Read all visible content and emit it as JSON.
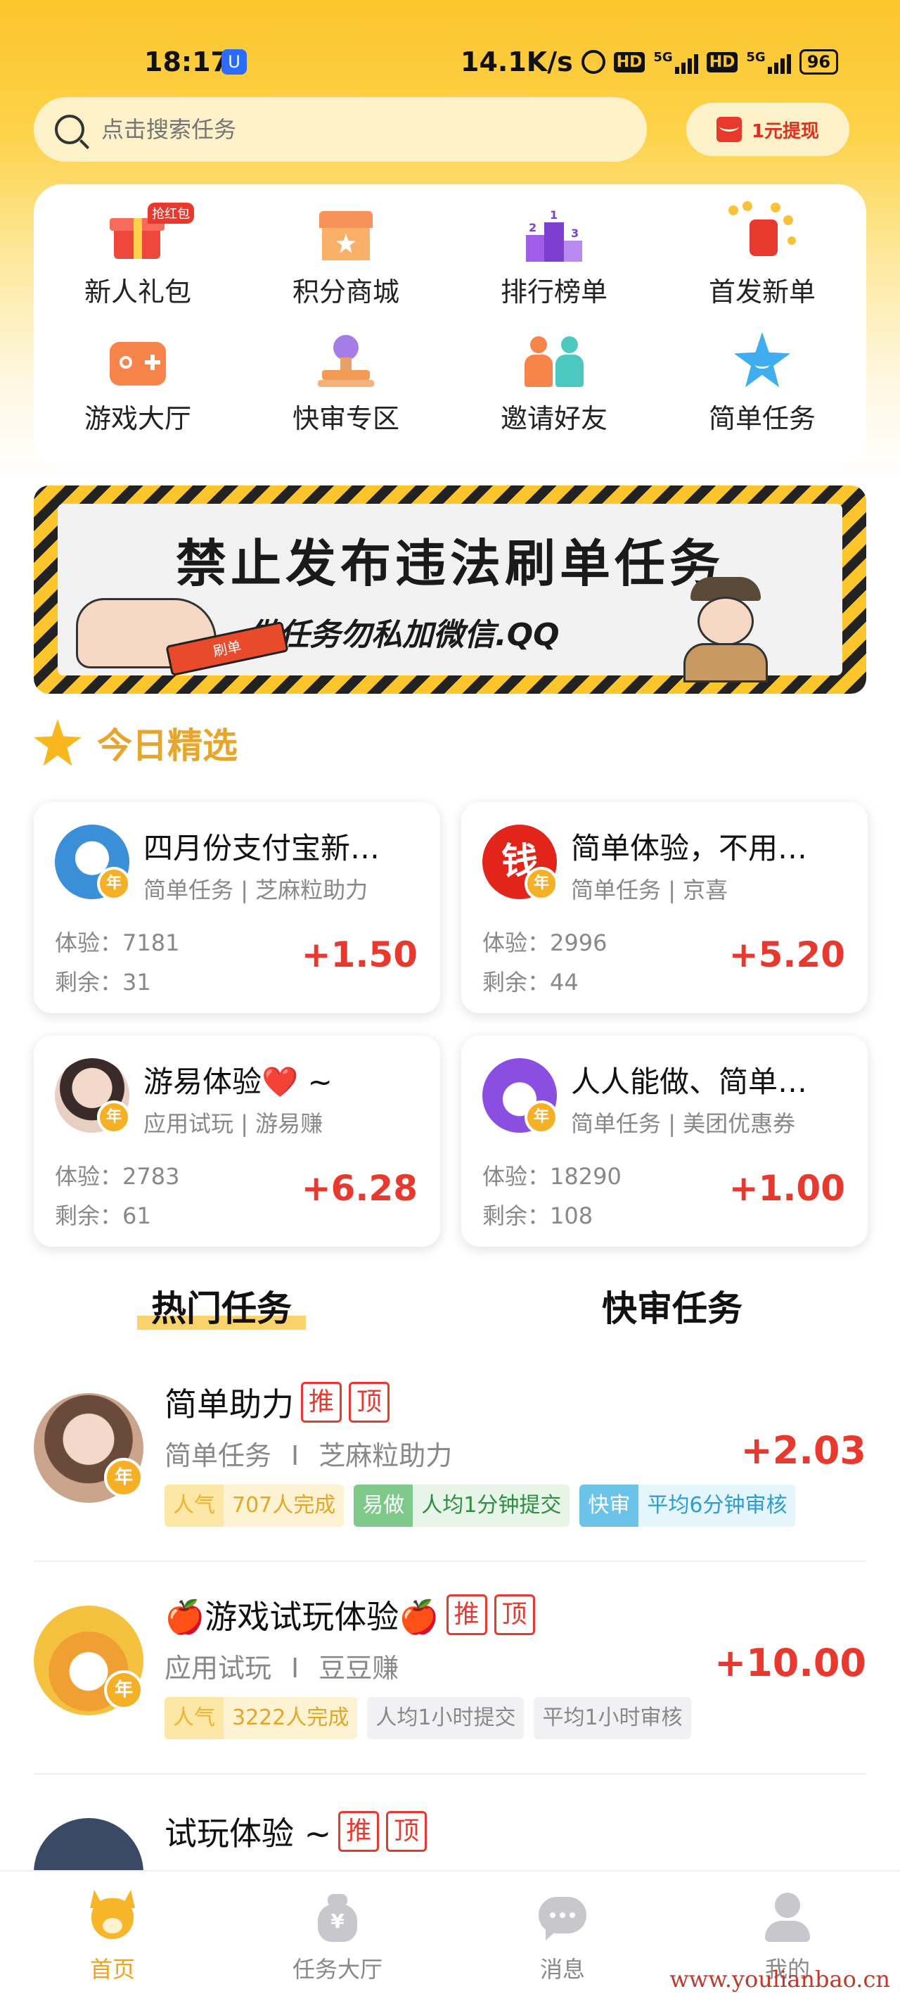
{
  "status_bar": {
    "time": "18:17",
    "speed": "14.1K/s",
    "hd1": "HD",
    "net1": "5G",
    "hd2": "HD",
    "net2": "5G",
    "battery": "96"
  },
  "search": {
    "placeholder": "点击搜索任务",
    "withdraw_label": "1元提现"
  },
  "quick_menu": [
    {
      "label": "新人礼包",
      "icon": "gift-icon",
      "badge": "抢红包"
    },
    {
      "label": "积分商城",
      "icon": "store-icon"
    },
    {
      "label": "排行榜单",
      "icon": "podium-icon",
      "ranks": [
        "1",
        "2",
        "3"
      ]
    },
    {
      "label": "首发新单",
      "icon": "coins-icon"
    },
    {
      "label": "游戏大厅",
      "icon": "gamepad-icon"
    },
    {
      "label": "快审专区",
      "icon": "stamp-icon"
    },
    {
      "label": "邀请好友",
      "icon": "people-icon"
    },
    {
      "label": "简单任务",
      "icon": "star-smile-icon"
    }
  ],
  "banner": {
    "title": "禁止发布违法刷单任务",
    "subtitle": "做任务勿私加微信.QQ",
    "phone_text": "刷单"
  },
  "today_pick": {
    "title": "今日精选",
    "stat_labels": {
      "exp": "体验：",
      "remain": "剩余："
    },
    "items": [
      {
        "title": "四月份支付宝新…",
        "category": "简单任务",
        "source": "芝麻粒助力",
        "exp": "7181",
        "remain": "31",
        "price": "+1.50",
        "avatar_color": "#3a8fd8",
        "year": "年"
      },
      {
        "title": "简单体验，不用…",
        "category": "简单任务",
        "source": "京喜",
        "exp": "2996",
        "remain": "44",
        "price": "+5.20",
        "avatar_color": "#e3241b",
        "avatar_char": "钱",
        "year": "年"
      },
      {
        "title": "游易体验❤️ ~",
        "category": "应用试玩",
        "source": "游易赚",
        "exp": "2783",
        "remain": "61",
        "price": "+6.28",
        "avatar_color": "#e9cfc2",
        "year": "年"
      },
      {
        "title": "人人能做、简单…",
        "category": "简单任务",
        "source": "美团优惠券",
        "exp": "18290",
        "remain": "108",
        "price": "+1.00",
        "avatar_color": "#8a4fe0",
        "year": "年"
      }
    ]
  },
  "tabs": {
    "hot": "热门任务",
    "fast": "快审任务"
  },
  "tasks": [
    {
      "title": "简单助力",
      "badges": [
        "推",
        "顶"
      ],
      "category": "简单任务",
      "sep": "I",
      "source": "芝麻粒助力",
      "price": "+2.03",
      "avatar_color": "#caa58c",
      "year": "年",
      "tags": [
        {
          "type": "pop",
          "k": "人气",
          "v": "707人完成"
        },
        {
          "type": "easy",
          "k": "易做",
          "v": "人均1分钟提交"
        },
        {
          "type": "fast",
          "k": "快审",
          "v": "平均6分钟审核"
        }
      ]
    },
    {
      "title": "🍎游戏试玩体验🍎",
      "badges": [
        "推",
        "顶"
      ],
      "category": "应用试玩",
      "sep": "I",
      "source": "豆豆赚",
      "price": "+10.00",
      "avatar_color": "#f4c23e",
      "year": "年",
      "tags": [
        {
          "type": "pop",
          "k": "人气",
          "v": "3222人完成"
        },
        {
          "type": "gray",
          "k": "",
          "v": "人均1小时提交"
        },
        {
          "type": "gray",
          "k": "",
          "v": "平均1小时审核"
        }
      ]
    },
    {
      "title": "试玩体验 ~",
      "badges": [
        "推",
        "顶"
      ],
      "avatar_color": "#3a4a66"
    }
  ],
  "bottom_nav": [
    {
      "label": "首页",
      "icon": "home-cat-icon",
      "active": true
    },
    {
      "label": "任务大厅",
      "icon": "money-bag-icon"
    },
    {
      "label": "消息",
      "icon": "chat-icon"
    },
    {
      "label": "我的",
      "icon": "profile-icon"
    }
  ],
  "watermark": "www.youlianbao.cn",
  "colors": {
    "accent": "#fcc52c",
    "price_red": "#e8392e",
    "section_gold": "#e6a62c"
  }
}
